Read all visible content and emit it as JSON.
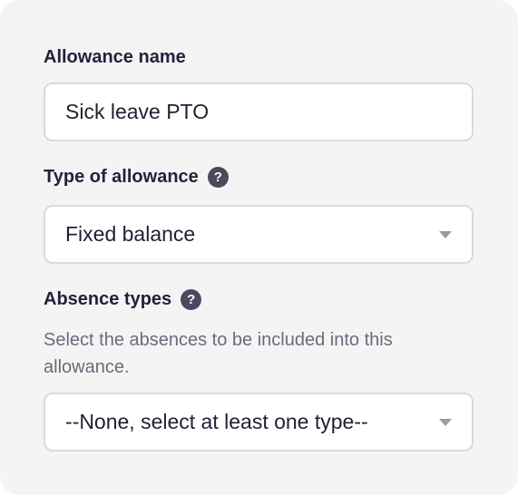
{
  "form": {
    "allowance_name": {
      "label": "Allowance name",
      "value": "Sick leave PTO"
    },
    "type_of_allowance": {
      "label": "Type of allowance",
      "help_icon": "question-mark-icon",
      "help_glyph": "?",
      "selected": "Fixed balance"
    },
    "absence_types": {
      "label": "Absence types",
      "help_icon": "question-mark-icon",
      "help_glyph": "?",
      "helper": "Select the absences to be included into this allowance.",
      "selected": "--None, select at least one type--"
    }
  },
  "colors": {
    "card_background": "#f4f4f5",
    "input_border": "#dadade",
    "help_icon_background": "#4a4a5e",
    "helper_text": "#6b6b7b",
    "caret": "#9a9aa6"
  }
}
